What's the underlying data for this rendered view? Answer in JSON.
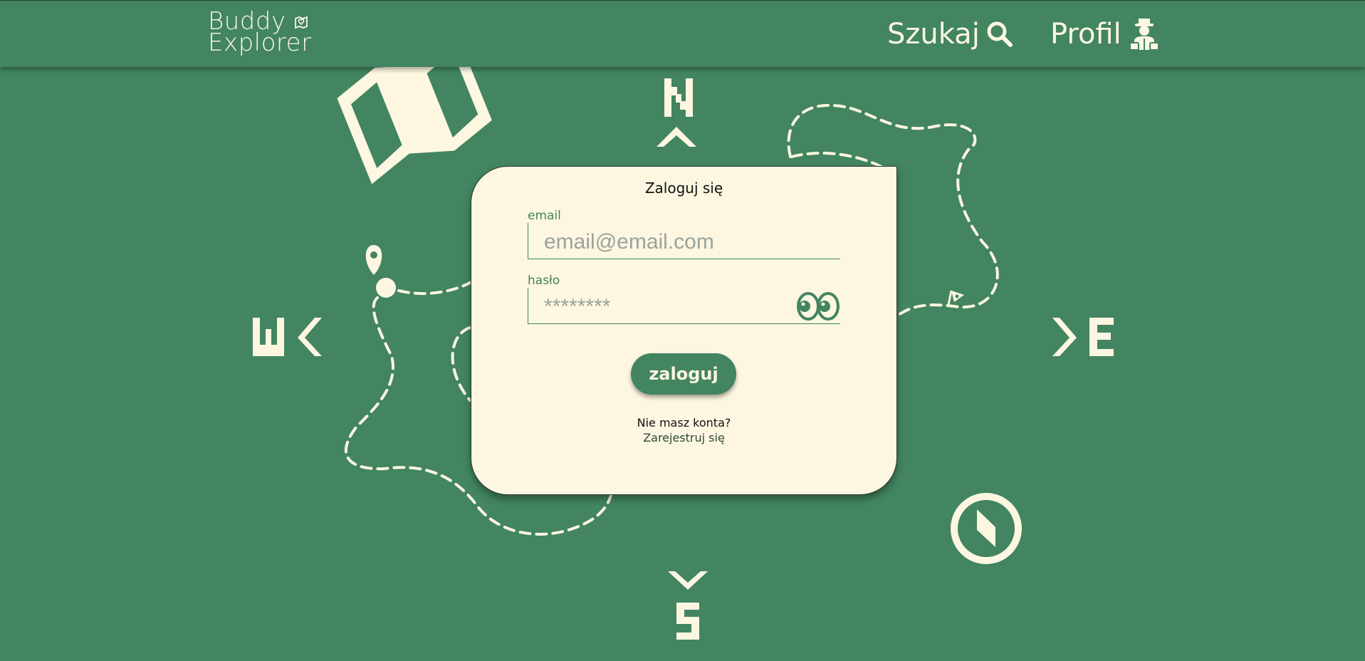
{
  "header": {
    "logo_line1": "Buddy",
    "logo_line2": "Explorer",
    "search_label": "Szukaj",
    "profile_label": "Profil"
  },
  "login": {
    "title": "Zaloguj się",
    "email_label": "email",
    "email_placeholder": "email@email.com",
    "password_label": "hasło",
    "password_placeholder": "********",
    "submit_label": "zaloguj",
    "no_account_text": "Nie masz konta?",
    "register_link": "Zarejestruj się"
  },
  "colors": {
    "background": "#428560",
    "cream": "#fdf6e0",
    "accent_text": "#428560"
  },
  "icons": {
    "search": "magnifier-icon",
    "profile": "explorer-avatar-icon",
    "logo": "map-pin-heart-icon",
    "password_toggle": "eyes-icon",
    "map": "folded-map-icon",
    "pin": "location-pin-icon",
    "flag": "flag-icon",
    "compass": "compass-icon"
  }
}
